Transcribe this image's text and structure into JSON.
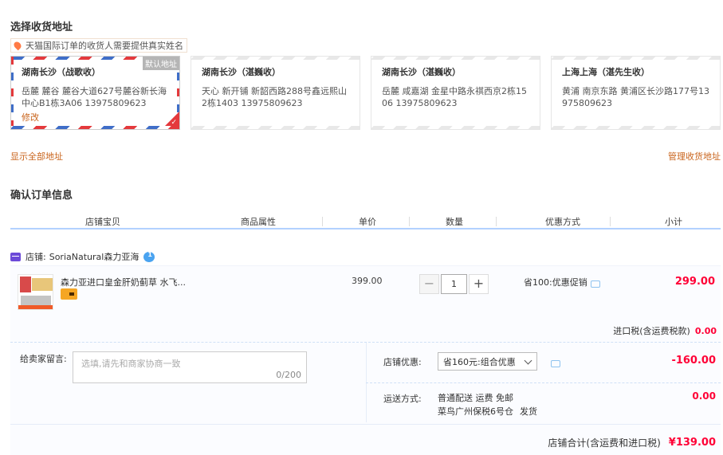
{
  "address_section": {
    "title": "选择收货地址",
    "notice": "天猫国际订单的收货人需要提供真实姓名",
    "cards": [
      {
        "name": "湖南长沙（战歌收）",
        "detail": "岳麓 麓谷 麓谷大道627号麓谷新长海中心B1栋3A06 13975809623",
        "edit": "修改",
        "default_tag": "默认地址",
        "selected": true
      },
      {
        "name": "湖南长沙（湛巍收）",
        "detail": "天心 新开铺 新韶西路288号鑫远熙山2栋1403 13975809623",
        "selected": false
      },
      {
        "name": "湖南长沙（湛巍收）",
        "detail": "岳麓 咸嘉湖 金星中路永祺西京2栋1506 13975809623",
        "selected": false
      },
      {
        "name": "上海上海（湛先生收）",
        "detail": "黄浦 南京东路 黄浦区长沙路177号13975809623",
        "selected": false
      }
    ],
    "show_all": "显示全部地址",
    "manage": "管理收货地址"
  },
  "order_section": {
    "title": "确认订单信息",
    "columns": [
      "店铺宝贝",
      "商品属性",
      "单价",
      "数量",
      "优惠方式",
      "小计"
    ],
    "shop_label": "店铺:",
    "shop_name": "SoriaNatural森力亚海",
    "item": {
      "title": "森力亚进口皇金肝奶蓟草 水飞...",
      "price": "399.00",
      "quantity": "1",
      "minus": "−",
      "plus": "+",
      "promo": "省100:优惠促销",
      "subtotal": "299.00"
    },
    "tax_label": "进口税(含运费税款)",
    "tax_value": "0.00",
    "message_label": "给卖家留言:",
    "message_placeholder": "选填,请先和商家协商一致",
    "message_count": "0/200",
    "coupon_label": "店铺优惠:",
    "coupon_value": "省160元:组合优惠",
    "discount": "-160.00",
    "shipping_label": "运送方式:",
    "shipping_line1": "普通配送 运费 免邮",
    "shipping_line2": "菜鸟广州保税6号仓",
    "shipping_send": "发货",
    "shipping_fee": "0.00",
    "total_label": "店铺合计(含运费和进口税)",
    "total_value": "¥139.00"
  },
  "colors": {
    "accent": "#ff0036",
    "link": "#c9641c",
    "table_border": "#b2d1ff"
  }
}
